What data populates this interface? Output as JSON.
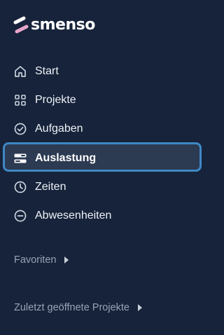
{
  "brand": {
    "name": "smenso"
  },
  "nav": {
    "items": [
      {
        "label": "Start",
        "icon": "home-icon"
      },
      {
        "label": "Projekte",
        "icon": "grid-icon"
      },
      {
        "label": "Aufgaben",
        "icon": "check-circle-icon"
      },
      {
        "label": "Auslastung",
        "icon": "workload-icon",
        "active": true
      },
      {
        "label": "Zeiten",
        "icon": "clock-icon"
      },
      {
        "label": "Abwesenheiten",
        "icon": "minus-circle-icon"
      }
    ]
  },
  "sections": {
    "favorites": {
      "label": "Favoriten",
      "icon": "caret-right-icon"
    },
    "recent": {
      "label": "Zuletzt geöffnete Projekte",
      "icon": "caret-right-icon"
    }
  },
  "colors": {
    "background": "#16233a",
    "active_bg": "#2c3a52",
    "active_border": "#3f88c5",
    "brand_accent_white": "#ffffff",
    "brand_accent_pink": "#e8a6c9"
  }
}
